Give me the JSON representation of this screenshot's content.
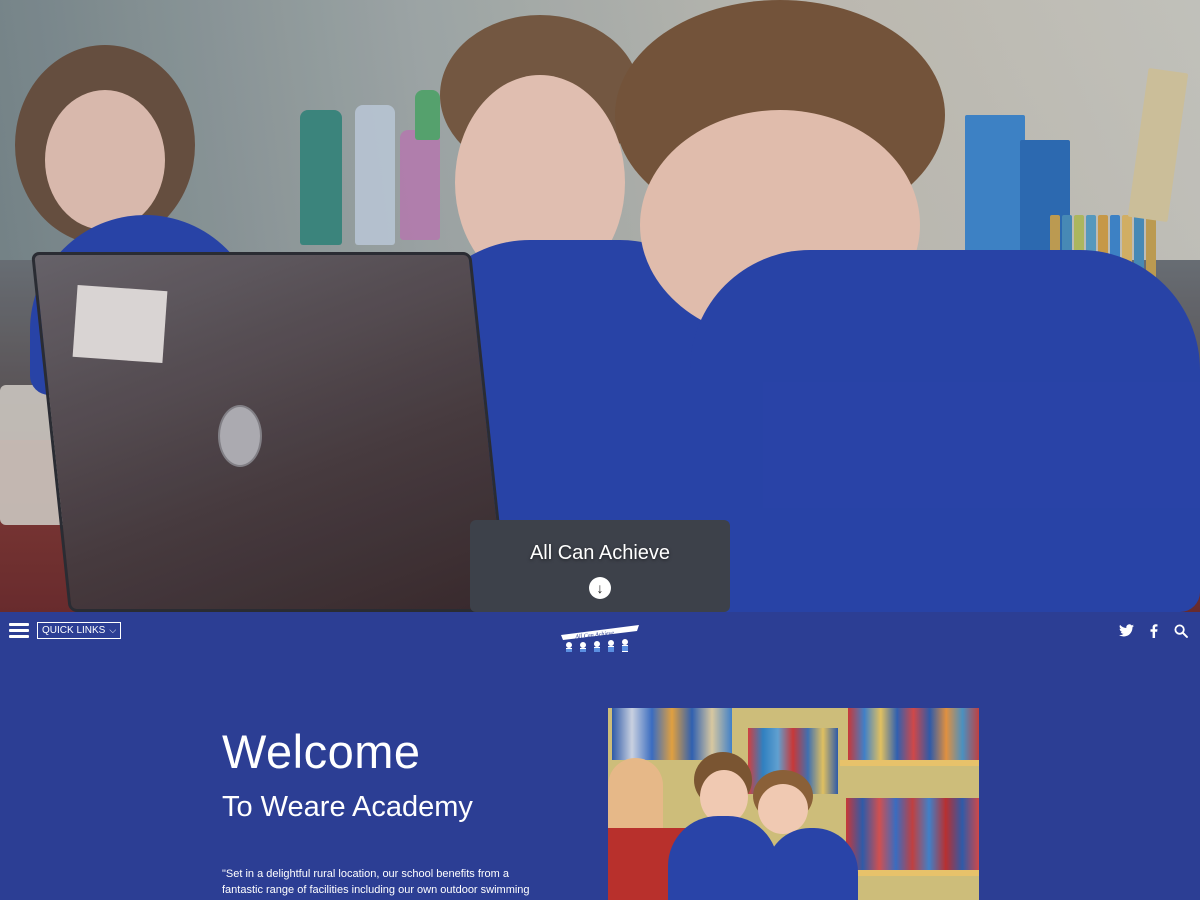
{
  "hero": {
    "tagline": "All Can Achieve",
    "scroll_icon": "arrow-down-circle-icon"
  },
  "nav": {
    "menu_icon": "hamburger-menu-icon",
    "quick_links_label": "QUICK LINKS",
    "quick_links_chevron": "chevron-down-icon",
    "logo_text": "All Can Achieve",
    "social": [
      {
        "name": "twitter-icon",
        "glyph": "t"
      },
      {
        "name": "facebook-icon",
        "glyph": "f"
      },
      {
        "name": "search-icon",
        "glyph": "⌕"
      }
    ]
  },
  "welcome": {
    "title": "Welcome",
    "subtitle": "To Weare Academy",
    "quote": "\"Set in a delightful rural location, our school benefits from a fantastic range of facilities including our own outdoor swimming"
  },
  "colors": {
    "brand_blue": "#2c3e94",
    "text": "#ffffff"
  }
}
